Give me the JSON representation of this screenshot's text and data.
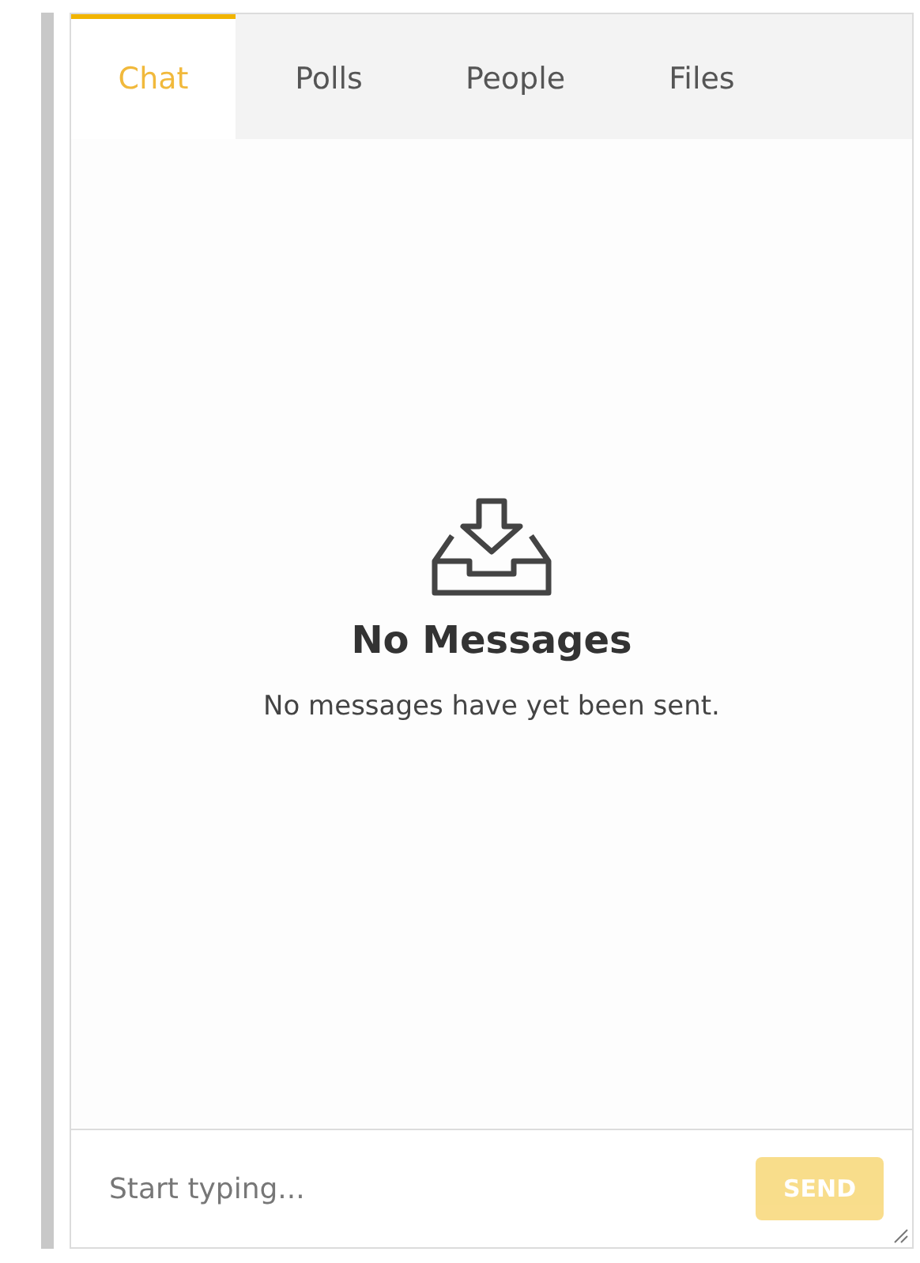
{
  "tabs": [
    {
      "label": "Chat",
      "selected": true
    },
    {
      "label": "Polls",
      "selected": false
    },
    {
      "label": "People",
      "selected": false
    },
    {
      "label": "Files",
      "selected": false
    }
  ],
  "empty_state": {
    "title": "No Messages",
    "message": "No messages have yet been sent."
  },
  "composer": {
    "placeholder": "Start typing...",
    "send": {
      "label": "SEND",
      "disabled": true
    }
  }
}
